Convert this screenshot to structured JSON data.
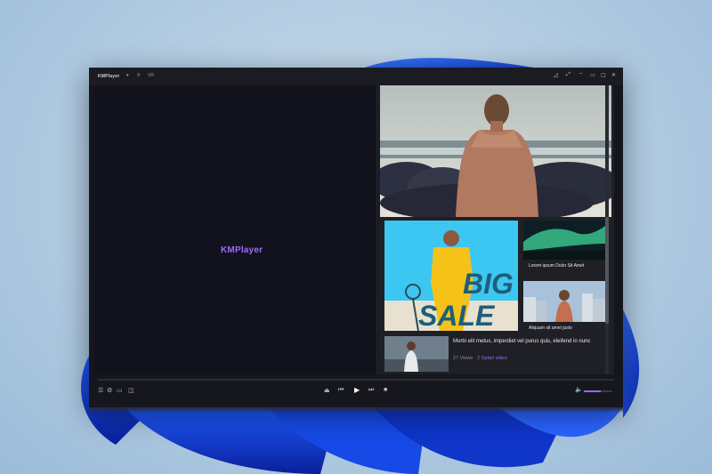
{
  "app": {
    "brand": "KMPlayer",
    "title_extra": "VR",
    "center_logo": "KMPlayer"
  },
  "titlebar": {
    "menu_caret": "▾",
    "pin_icon": "pin-icon",
    "controls": [
      "◿",
      "⤢",
      "▭",
      "▢",
      "✕"
    ]
  },
  "content": {
    "tiles": [
      {
        "caption": "Lorem ipsum Dolor Sit Amet"
      },
      {
        "caption": "Aliquam sit amet justo"
      }
    ],
    "promo": {
      "line1": "BIG",
      "line2": "SALE"
    },
    "list_item": {
      "title": "Morbi elit metus, imperdiet vel purus quis, eleifend in nunc",
      "views": "27 Views",
      "separator": "·",
      "channel": "2 Safari video"
    }
  },
  "controls": {
    "left_icons": [
      "playlist-icon",
      "settings-icon",
      "screenshot-icon",
      "vr-icon"
    ],
    "transport": [
      "⏏",
      "⏮",
      "▶",
      "⏭",
      "■"
    ],
    "volume_level": 0.6
  },
  "colors": {
    "accent": "#8f6bff",
    "window_bg": "#15151d",
    "pane_bg": "#12121c"
  }
}
